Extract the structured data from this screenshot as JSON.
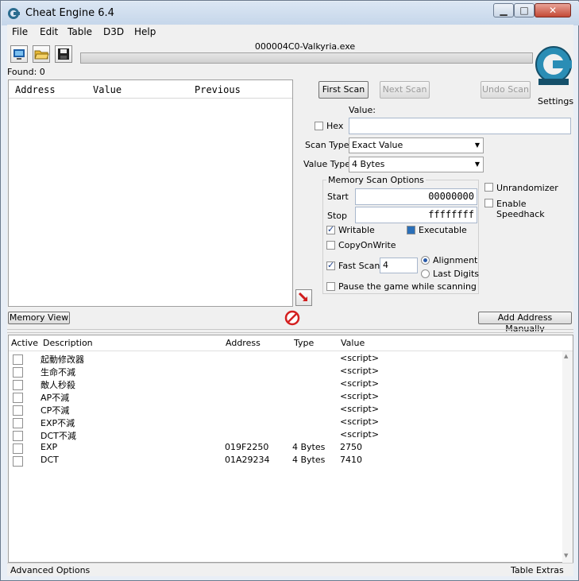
{
  "window": {
    "title": "Cheat Engine 6.4"
  },
  "menu": [
    "File",
    "Edit",
    "Table",
    "D3D",
    "Help"
  ],
  "process_name": "000004C0-Valkyria.exe",
  "found": "Found: 0",
  "results_columns": [
    "Address",
    "Value",
    "Previous"
  ],
  "buttons": {
    "first_scan": "First Scan",
    "next_scan": "Next Scan",
    "undo_scan": "Undo Scan",
    "settings": "Settings",
    "memory_view": "Memory View",
    "add_address": "Add Address Manually"
  },
  "scan": {
    "value_label": "Value:",
    "hex_label": "Hex",
    "scan_type_label": "Scan Type",
    "scan_type_value": "Exact Value",
    "value_type_label": "Value Type",
    "value_type_value": "4 Bytes",
    "mem_group_label": "Memory Scan Options",
    "start_label": "Start",
    "start_value": "00000000",
    "stop_label": "Stop",
    "stop_value": "ffffffff",
    "writable": "Writable",
    "executable": "Executable",
    "copyonwrite": "CopyOnWrite",
    "fast_scan": "Fast Scan",
    "fast_scan_value": "4",
    "alignment": "Alignment",
    "last_digits": "Last Digits",
    "pause": "Pause the game while scanning",
    "unrandomizer": "Unrandomizer",
    "speedhack": "Enable Speedhack"
  },
  "table_columns": [
    "Active",
    "Description",
    "Address",
    "Type",
    "Value"
  ],
  "table_rows": [
    {
      "desc": "起動修改器",
      "address": "",
      "type": "",
      "value": "<script>"
    },
    {
      "desc": "生命不減",
      "address": "",
      "type": "",
      "value": "<script>"
    },
    {
      "desc": "敵人秒殺",
      "address": "",
      "type": "",
      "value": "<script>"
    },
    {
      "desc": "AP不減",
      "address": "",
      "type": "",
      "value": "<script>"
    },
    {
      "desc": "CP不減",
      "address": "",
      "type": "",
      "value": "<script>"
    },
    {
      "desc": "EXP不減",
      "address": "",
      "type": "",
      "value": "<script>"
    },
    {
      "desc": "DCT不減",
      "address": "",
      "type": "",
      "value": "<script>"
    },
    {
      "desc": "EXP",
      "address": "019F2250",
      "type": "4 Bytes",
      "value": "2750"
    },
    {
      "desc": "DCT",
      "address": "01A29234",
      "type": "4 Bytes",
      "value": "7410"
    }
  ],
  "footer": {
    "advanced": "Advanced Options",
    "extras": "Table Extras"
  },
  "logo": {
    "text": "Cheat Engine",
    "color": "#1e7fa8"
  }
}
